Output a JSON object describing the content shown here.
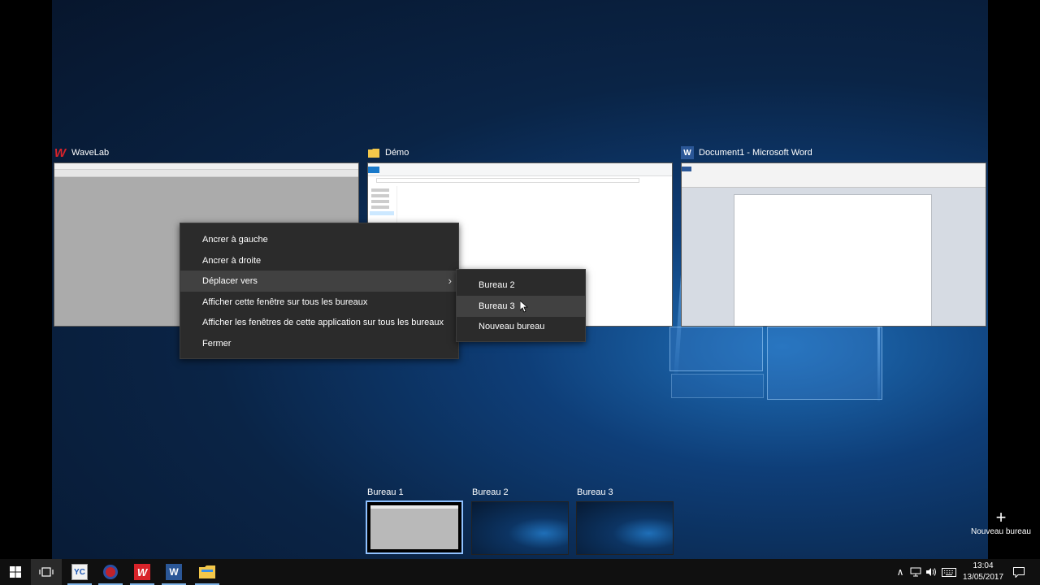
{
  "windows": [
    {
      "title": "WaveLab",
      "icon": "wavelab-icon"
    },
    {
      "title": "Démo",
      "icon": "folder-icon"
    },
    {
      "title": "Document1 - Microsoft Word",
      "icon": "word-icon"
    }
  ],
  "context_menu": {
    "items": [
      "Ancrer à gauche",
      "Ancrer à droite",
      "Déplacer vers",
      "Afficher cette fenêtre sur tous les bureaux",
      "Afficher les fenêtres de cette application sur tous les bureaux",
      "Fermer"
    ],
    "highlighted_item": "Déplacer vers"
  },
  "submenu": {
    "items": [
      "Bureau 2",
      "Bureau 3",
      "Nouveau bureau"
    ],
    "highlighted_item": "Bureau 3"
  },
  "virtual_desktops": {
    "desktops": [
      "Bureau 1",
      "Bureau 2",
      "Bureau 3"
    ],
    "active": "Bureau 1",
    "new_desktop_label": "Nouveau bureau"
  },
  "taskbar": {
    "time": "13:04",
    "date": "13/05/2017",
    "apps": [
      "yc-app-icon",
      "media-recorder-icon",
      "wavelab-icon",
      "word-icon",
      "file-explorer-icon"
    ]
  },
  "colors": {
    "menu_bg": "#2b2b2b",
    "menu_highlight": "#414141",
    "active_desktop_border": "#8fc1ff",
    "wavelab_red": "#d8232a",
    "word_blue": "#2b5797",
    "folder_yellow": "#f3c74a"
  }
}
